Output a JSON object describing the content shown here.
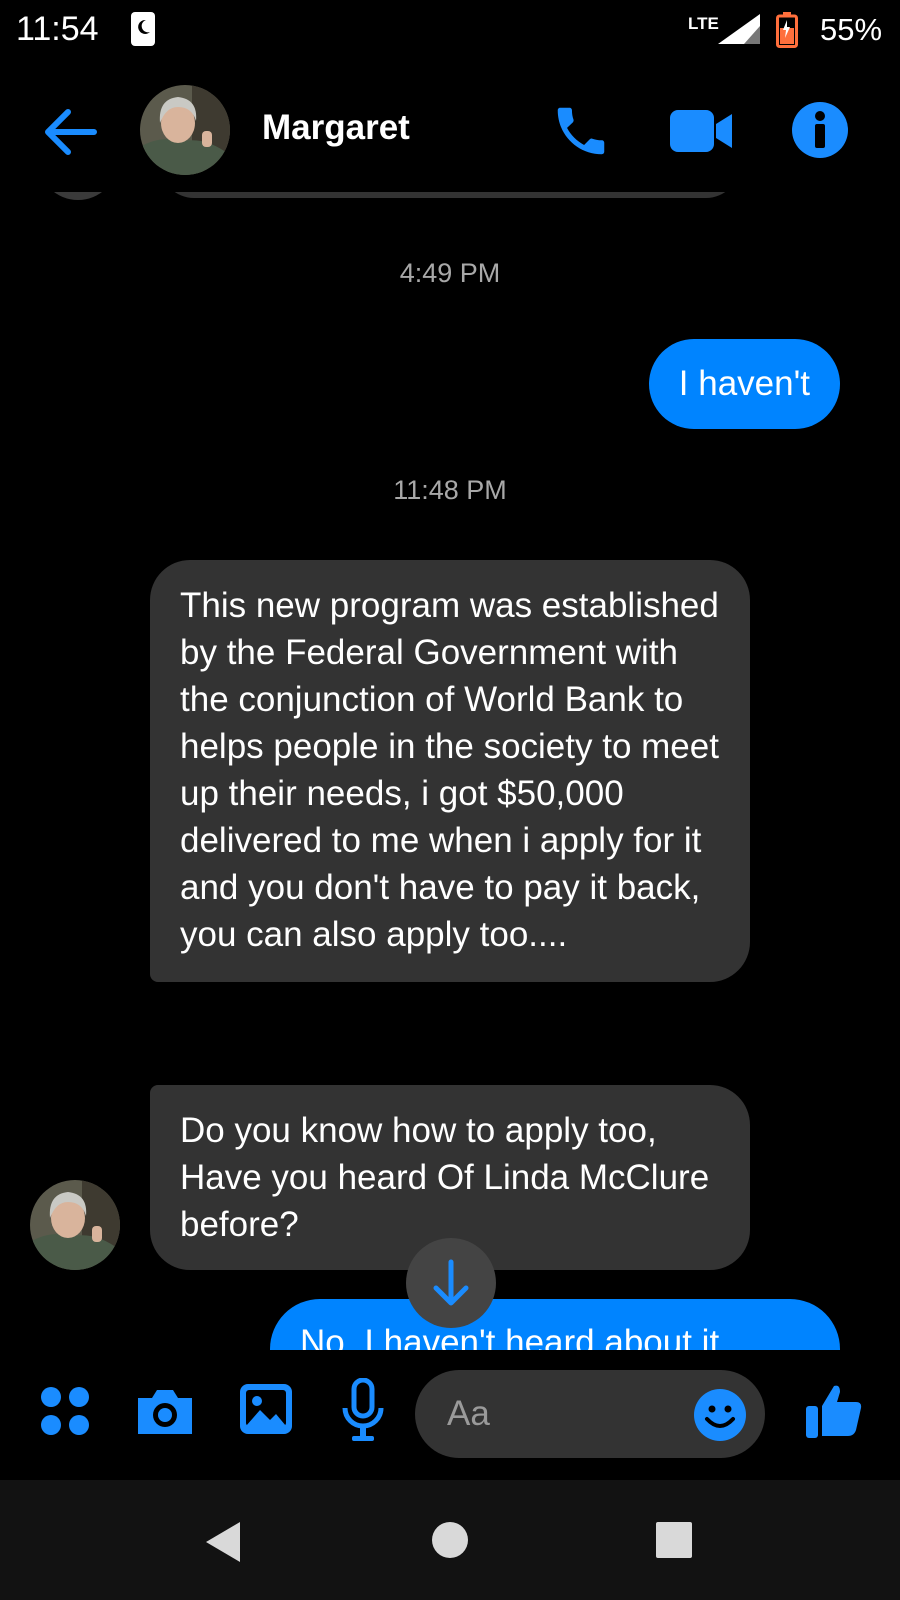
{
  "status_bar": {
    "time": "11:54",
    "network": "LTE",
    "battery": "55%",
    "icons": [
      "alarm-icon",
      "signal-icon",
      "battery-icon"
    ]
  },
  "header": {
    "contact_name": "Margaret",
    "icons": [
      "back-arrow-icon",
      "phone-icon",
      "video-camera-icon",
      "info-icon"
    ]
  },
  "messages": [
    {
      "type": "timestamp",
      "text": "4:49 PM"
    },
    {
      "type": "outgoing",
      "text": "I haven't"
    },
    {
      "type": "timestamp",
      "text": "11:48 PM"
    },
    {
      "type": "incoming",
      "text": "This new program was established by the Federal Government with the conjunction of World Bank to helps people in the society to meet up their needs, i got $50,000 delivered to me when i apply for it and you don't have to pay it back, you can also apply too...."
    },
    {
      "type": "incoming",
      "text": "Do you know how to apply too, Have you heard Of Linda McClure before?"
    },
    {
      "type": "outgoing",
      "text": "No, I haven't heard about it"
    }
  ],
  "composer": {
    "placeholder": "Aa",
    "icons": [
      "apps-icon",
      "camera-icon",
      "gallery-icon",
      "microphone-icon",
      "emoji-icon",
      "thumbs-up-icon"
    ]
  },
  "colors": {
    "accent": "#0084ff",
    "incoming_bubble": "#333333",
    "background": "#000000"
  }
}
